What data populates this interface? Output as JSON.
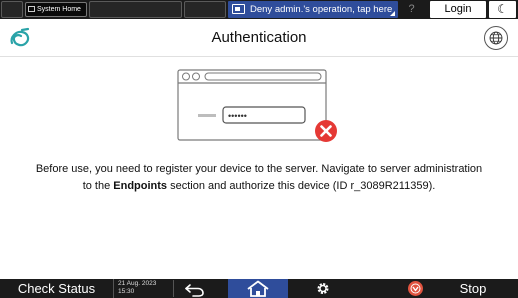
{
  "topbar": {
    "system_home_label": "System Home",
    "deny_label": "Deny admin.'s operation, tap here",
    "help_label": "?",
    "login_label": "Login",
    "moon_label": "☾"
  },
  "header": {
    "title": "Authentication"
  },
  "illustration": {
    "password_mask": "••••••"
  },
  "message": {
    "line1": "Before use, you need to register your device to the server. Navigate to server administration",
    "line2_prefix": "to the ",
    "line2_bold": "Endpoints",
    "line2_suffix": " section and authorize this device (ID r_3089R211359)."
  },
  "bottombar": {
    "check_status_label": "Check Status",
    "date": "21 Aug. 2023",
    "time": "15:30",
    "stop_label": "Stop"
  },
  "colors": {
    "accent_blue": "#2f4d9b",
    "error_red": "#e53935",
    "bar_dark": "#1b1b1b"
  }
}
